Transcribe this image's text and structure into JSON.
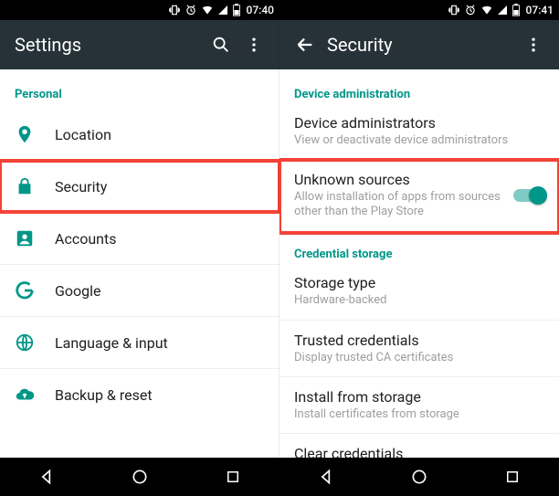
{
  "accent": "#009688",
  "left": {
    "status_time": "07:40",
    "appbar": {
      "title": "Settings"
    },
    "section": "Personal",
    "items": [
      {
        "label": "Location"
      },
      {
        "label": "Security"
      },
      {
        "label": "Accounts"
      },
      {
        "label": "Google"
      },
      {
        "label": "Language & input"
      },
      {
        "label": "Backup & reset"
      }
    ]
  },
  "right": {
    "status_time": "07:41",
    "appbar": {
      "title": "Security"
    },
    "sections": {
      "device_admin": "Device administration",
      "cred_storage": "Credential storage"
    },
    "items": {
      "device_admins": {
        "title": "Device administrators",
        "sub": "View or deactivate device administrators"
      },
      "unknown_sources": {
        "title": "Unknown sources",
        "sub": "Allow installation of apps from sources other than the Play Store",
        "enabled": true
      },
      "storage_type": {
        "title": "Storage type",
        "sub": "Hardware-backed"
      },
      "trusted_credentials": {
        "title": "Trusted credentials",
        "sub": "Display trusted CA certificates"
      },
      "install_from_storage": {
        "title": "Install from storage",
        "sub": "Install certificates from storage"
      },
      "clear_credentials": {
        "title": "Clear credentials"
      }
    }
  }
}
